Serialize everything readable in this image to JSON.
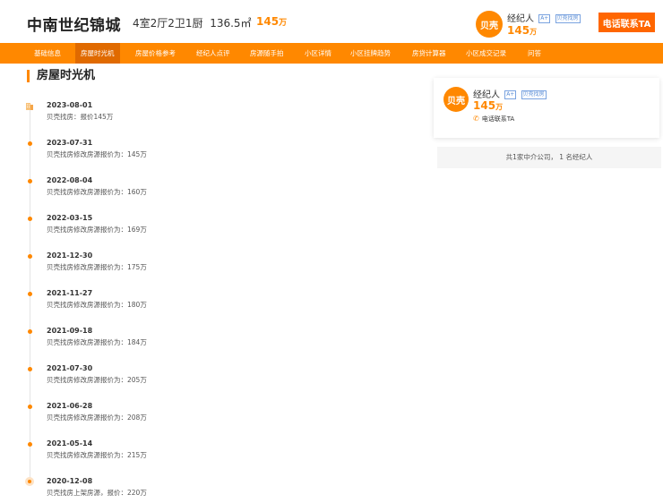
{
  "header": {
    "title": "中南世纪锦城",
    "specs": "4室2厅2卫1厨",
    "area": "136.5㎡",
    "price_value": "145",
    "price_unit": "万"
  },
  "agent": {
    "avatar_text": "贝壳",
    "name": "经纪人",
    "tag1": "A+",
    "tag2": "贝壳找房",
    "price_value": "145",
    "price_unit": "万",
    "call_label": "电话联系TA",
    "phone_label": "电话联系TA"
  },
  "nav": {
    "items": [
      {
        "label": "基础信息"
      },
      {
        "label": "房屋时光机",
        "active": true
      },
      {
        "label": "房屋价格参考"
      },
      {
        "label": "经纪人点评"
      },
      {
        "label": "房源随手拍"
      },
      {
        "label": "小区详情"
      },
      {
        "label": "小区挂牌趋势"
      },
      {
        "label": "房贷计算器"
      },
      {
        "label": "小区成交记录"
      },
      {
        "label": "问答"
      }
    ]
  },
  "timeline": {
    "title": "房屋时光机",
    "entries": [
      {
        "date": "2023-08-01",
        "desc": "贝壳找房：报价145万"
      },
      {
        "date": "2023-07-31",
        "desc": "贝壳找房修改房源报价为：145万"
      },
      {
        "date": "2022-08-04",
        "desc": "贝壳找房修改房源报价为：160万"
      },
      {
        "date": "2022-03-15",
        "desc": "贝壳找房修改房源报价为：169万"
      },
      {
        "date": "2021-12-30",
        "desc": "贝壳找房修改房源报价为：175万"
      },
      {
        "date": "2021-11-27",
        "desc": "贝壳找房修改房源报价为：180万"
      },
      {
        "date": "2021-09-18",
        "desc": "贝壳找房修改房源报价为：184万"
      },
      {
        "date": "2021-07-30",
        "desc": "贝壳找房修改房源报价为：205万"
      },
      {
        "date": "2021-06-28",
        "desc": "贝壳找房修改房源报价为：208万"
      },
      {
        "date": "2021-05-14",
        "desc": "贝壳找房修改房源报价为：215万"
      },
      {
        "date": "2020-12-08",
        "desc": "贝壳找房上架房源，报价：220万"
      }
    ]
  },
  "side": {
    "summary": "共1家中介公司， 1 名经纪人"
  },
  "colors": {
    "accent": "#ff8800",
    "call_button": "#ff6600",
    "nav_active": "#e06a00"
  },
  "icons": {
    "first_entry": "building-icon",
    "phone": "phone-icon"
  }
}
